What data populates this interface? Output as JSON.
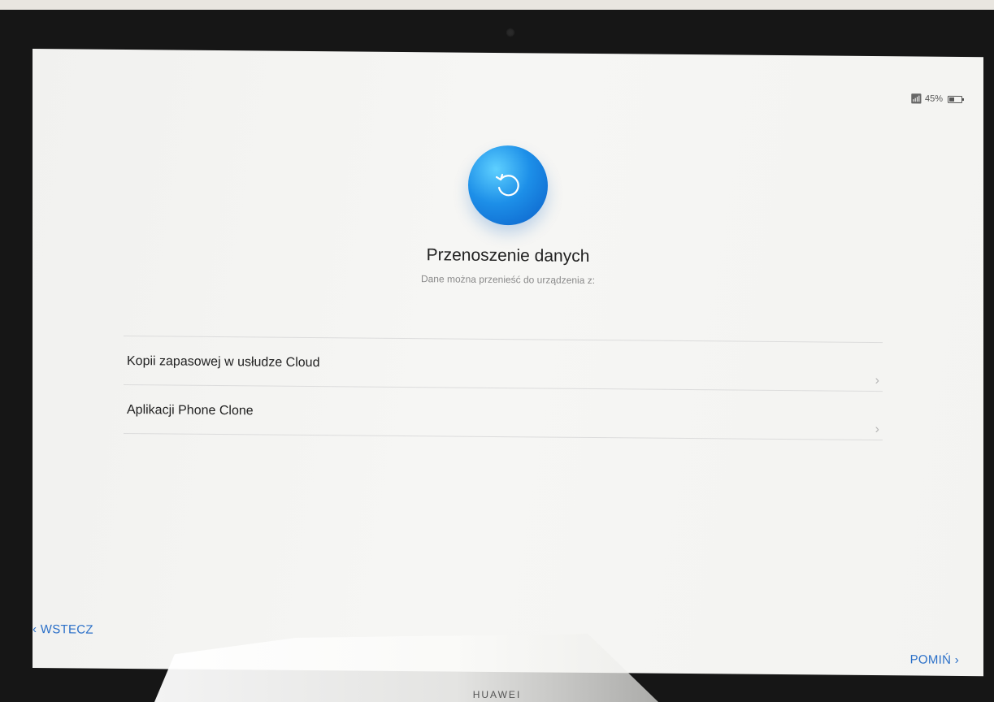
{
  "status_bar": {
    "battery_text": "45%"
  },
  "header": {
    "title": "Przenoszenie danych",
    "subtitle": "Dane można przenieść do urządzenia z:"
  },
  "options": [
    {
      "label": "Kopii zapasowej w usłudze Cloud"
    },
    {
      "label": "Aplikacji Phone Clone"
    }
  ],
  "nav": {
    "back_label": "WSTECZ",
    "skip_label": "POMIŃ"
  },
  "device": {
    "brand": "HUAWEI"
  },
  "colors": {
    "accent": "#2a6fc8",
    "hero_blue": "#1d8fe8"
  },
  "icons": {
    "hero": "restore-icon",
    "wifi": "wifi-icon",
    "battery": "battery-icon",
    "row_arrow": "chevron-right-icon",
    "back": "chevron-left-icon",
    "skip": "chevron-right-icon"
  }
}
